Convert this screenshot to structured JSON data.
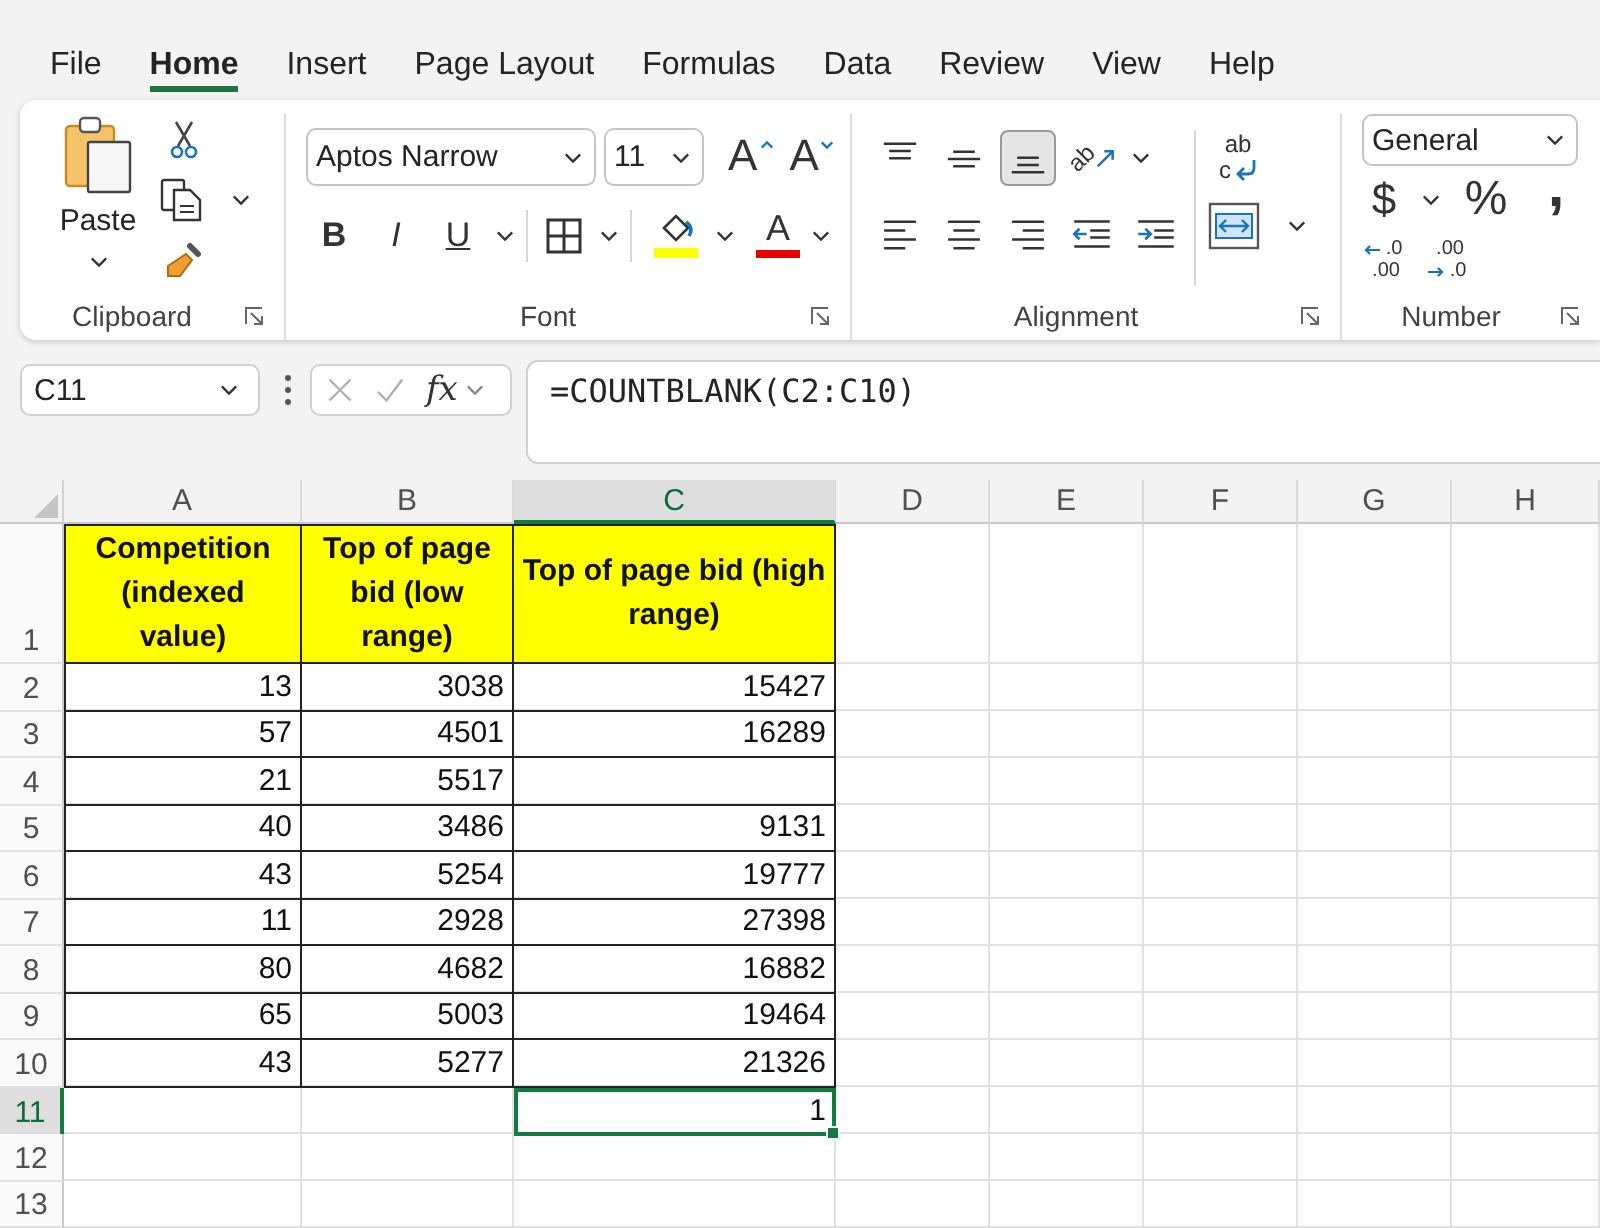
{
  "menu_tabs": [
    {
      "label": "File",
      "selected": false
    },
    {
      "label": "Home",
      "selected": true
    },
    {
      "label": "Insert",
      "selected": false
    },
    {
      "label": "Page Layout",
      "selected": false
    },
    {
      "label": "Formulas",
      "selected": false
    },
    {
      "label": "Data",
      "selected": false
    },
    {
      "label": "Review",
      "selected": false
    },
    {
      "label": "View",
      "selected": false
    },
    {
      "label": "Help",
      "selected": false
    }
  ],
  "ribbon": {
    "clipboard": {
      "paste": "Paste",
      "label": "Clipboard"
    },
    "font": {
      "font_name": "Aptos Narrow",
      "font_size": "11",
      "grow": "A",
      "shrink": "A",
      "bold": "B",
      "italic": "I",
      "underline": "U",
      "fill_color": {
        "color": "#ffff00"
      },
      "font_color": {
        "label": "A",
        "color": "#e60000"
      },
      "label": "Font"
    },
    "alignment": {
      "vertical": [
        {
          "kind": "top",
          "selected": false
        },
        {
          "kind": "middle",
          "selected": false
        },
        {
          "kind": "bottom",
          "selected": true
        }
      ],
      "orientation": "ab",
      "horizontal": [
        {
          "kind": "left",
          "selected": false
        },
        {
          "kind": "center",
          "selected": false
        },
        {
          "kind": "right",
          "selected": false
        }
      ],
      "wrap_text": {
        "top": "ab",
        "bottom": "c"
      },
      "label": "Alignment"
    },
    "number": {
      "format": "General",
      "currency": "$",
      "percent": "%",
      "comma": ",",
      "increase_decimal": {
        "top": ".0",
        "bottom": ".00"
      },
      "decrease_decimal": {
        "top": ".00",
        "bottom": ".0"
      },
      "label": "Number"
    }
  },
  "formula_bar": {
    "name_box": "C11",
    "fx": "fx",
    "formula": "=COUNTBLANK(C2:C10)"
  },
  "sheet": {
    "columns": [
      {
        "label": "A",
        "selected": false
      },
      {
        "label": "B",
        "selected": false
      },
      {
        "label": "C",
        "selected": true
      },
      {
        "label": "D",
        "selected": false
      },
      {
        "label": "E",
        "selected": false
      },
      {
        "label": "F",
        "selected": false
      },
      {
        "label": "G",
        "selected": false
      },
      {
        "label": "H",
        "selected": false
      }
    ],
    "rows": [
      {
        "label": "1",
        "selected": false,
        "kind": "header",
        "cells": [
          {
            "text": "Competition (indexed value)",
            "selected": false
          },
          {
            "text": "Top of page bid (low range)",
            "selected": false
          },
          {
            "text": "Top of page bid (high range)",
            "selected": false
          }
        ]
      },
      {
        "label": "2",
        "selected": false,
        "kind": "data",
        "cells": [
          {
            "text": "13",
            "selected": false
          },
          {
            "text": "3038",
            "selected": false
          },
          {
            "text": "15427",
            "selected": false
          }
        ]
      },
      {
        "label": "3",
        "selected": false,
        "kind": "data",
        "cells": [
          {
            "text": "57",
            "selected": false
          },
          {
            "text": "4501",
            "selected": false
          },
          {
            "text": "16289",
            "selected": false
          }
        ]
      },
      {
        "label": "4",
        "selected": false,
        "kind": "data",
        "cells": [
          {
            "text": "21",
            "selected": false
          },
          {
            "text": "5517",
            "selected": false
          },
          {
            "selected": false
          }
        ]
      },
      {
        "label": "5",
        "selected": false,
        "kind": "data",
        "cells": [
          {
            "text": "40",
            "selected": false
          },
          {
            "text": "3486",
            "selected": false
          },
          {
            "text": "9131",
            "selected": false
          }
        ]
      },
      {
        "label": "6",
        "selected": false,
        "kind": "data",
        "cells": [
          {
            "text": "43",
            "selected": false
          },
          {
            "text": "5254",
            "selected": false
          },
          {
            "text": "19777",
            "selected": false
          }
        ]
      },
      {
        "label": "7",
        "selected": false,
        "kind": "data",
        "cells": [
          {
            "text": "11",
            "selected": false
          },
          {
            "text": "2928",
            "selected": false
          },
          {
            "text": "27398",
            "selected": false
          }
        ]
      },
      {
        "label": "8",
        "selected": false,
        "kind": "data",
        "cells": [
          {
            "text": "80",
            "selected": false
          },
          {
            "text": "4682",
            "selected": false
          },
          {
            "text": "16882",
            "selected": false
          }
        ]
      },
      {
        "label": "9",
        "selected": false,
        "kind": "data",
        "cells": [
          {
            "text": "65",
            "selected": false
          },
          {
            "text": "5003",
            "selected": false
          },
          {
            "text": "19464",
            "selected": false
          }
        ]
      },
      {
        "label": "10",
        "selected": false,
        "kind": "data",
        "cells": [
          {
            "text": "43",
            "selected": false
          },
          {
            "text": "5277",
            "selected": false
          },
          {
            "text": "21326",
            "selected": false
          }
        ]
      },
      {
        "label": "11",
        "selected": true,
        "kind": "plain",
        "cells": [
          null,
          null,
          {
            "text": "1",
            "selected": true
          }
        ]
      },
      {
        "label": "12",
        "selected": false,
        "kind": "plain"
      },
      {
        "label": "13",
        "selected": false,
        "kind": "plain"
      }
    ]
  }
}
